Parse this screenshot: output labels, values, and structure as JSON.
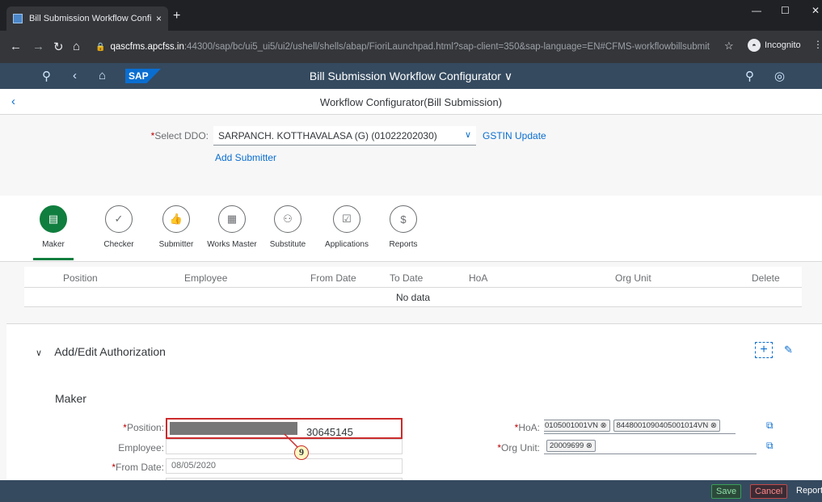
{
  "browser": {
    "tab_title": "Bill Submission Workflow Config",
    "tab_close": "×",
    "new_tab": "+",
    "url_host": "qascfms.apcfss.in",
    "url_path": ":44300/sap/bc/ui5_ui5/ui2/ushell/shells/abap/FioriLaunchpad.html?sap-client=350&sap-language=EN#CFMS-workflowbillsubmit",
    "incognito_label": "Incognito"
  },
  "shell": {
    "logo": "SAP",
    "title": "Bill Submission Workflow Configurator ∨"
  },
  "page": {
    "title": "Workflow Configurator(Bill Submission)"
  },
  "ddo": {
    "label": "Select DDO:",
    "value": "SARPANCH. KOTTHAVALASA (G) (01022202030)",
    "gstin_link": "GSTIN Update",
    "add_submitter": "Add Submitter"
  },
  "tabs": [
    {
      "label": "Maker",
      "glyph": "▤"
    },
    {
      "label": "Checker",
      "glyph": "✓"
    },
    {
      "label": "Submitter",
      "glyph": "👍"
    },
    {
      "label": "Works Master",
      "glyph": "▦"
    },
    {
      "label": "Substitute",
      "glyph": "⚇"
    },
    {
      "label": "Applications",
      "glyph": "☑"
    },
    {
      "label": "Reports",
      "glyph": "$"
    }
  ],
  "table": {
    "headers": [
      "Position",
      "Employee",
      "From Date",
      "To Date",
      "HoA",
      "Org Unit",
      "Delete"
    ],
    "empty_text": "No data"
  },
  "auth": {
    "title": "Add/Edit Authorization",
    "section": "Maker",
    "position_label": "Position:",
    "position_value": "30645145",
    "employee_label": "Employee:",
    "from_date_label": "From Date:",
    "from_date_value": "08/05/2020",
    "hoa_label": "HoA:",
    "hoa_tokens": [
      "0105001001VN ⊗",
      "8448001090405001014VN ⊗"
    ],
    "org_label": "Org Unit:",
    "org_tokens": [
      "20009699 ⊗"
    ],
    "callout": "9"
  },
  "footer": {
    "save": "Save",
    "cancel": "Cancel",
    "report": "Report"
  }
}
